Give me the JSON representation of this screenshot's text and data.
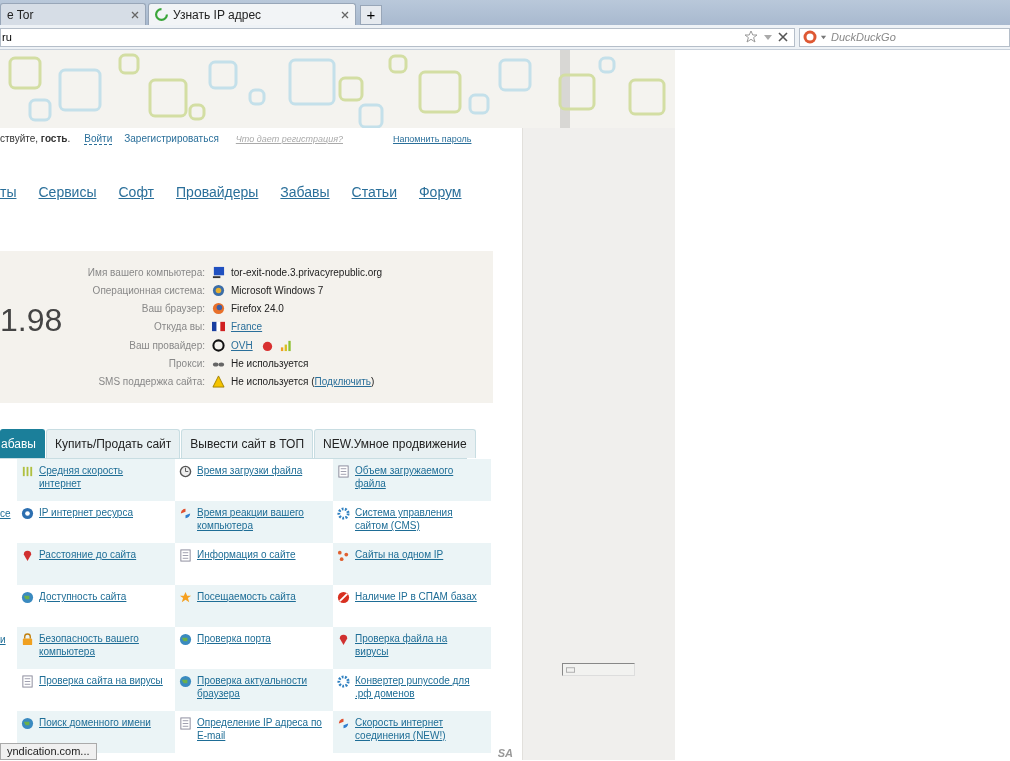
{
  "browser": {
    "tabs": [
      {
        "label": "e Tor",
        "selected": false
      },
      {
        "label": "Узнать IP адрес",
        "selected": true
      }
    ],
    "new_tab": "+",
    "address": "ru",
    "search_placeholder": "DuckDuckGo"
  },
  "login": {
    "greeting": "ствуйте, **гость**.",
    "login": "Войти",
    "register": "Зарегистрироваться",
    "why": "Что дает регистрация?",
    "remind": "Напомнить пароль"
  },
  "nav": [
    "ты",
    "Сервисы",
    "Софт",
    "Провайдеры",
    "Забавы",
    "Статьи",
    "Форум"
  ],
  "ip": "1.98",
  "info": [
    {
      "label": "Имя вашего компьютера:",
      "value": "tor-exit-node.3.privacyrepublic.org",
      "link": false
    },
    {
      "label": "Операционная система:",
      "value": "Microsoft Windows 7",
      "link": false
    },
    {
      "label": "Ваш браузер:",
      "value": "Firefox 24.0",
      "link": false
    },
    {
      "label": "Откуда вы:",
      "value": "France",
      "link": true
    },
    {
      "label": "Ваш провайдер:",
      "value": "OVH",
      "link": true
    },
    {
      "label": "Прокси:",
      "value": "Не используется",
      "link": false
    },
    {
      "label": "SMS поддержка сайта:",
      "value": "Не используется (",
      "link": false,
      "link_text": "Подключить",
      "tail": ")"
    }
  ],
  "site_tabs": [
    {
      "label": "абавы",
      "selected": true
    },
    {
      "label": "Купить/Продать сайт",
      "selected": false
    },
    {
      "label": "Вывести сайт в ТОП",
      "selected": false
    },
    {
      "label": "NEW.Умное продвижение",
      "selected": false
    }
  ],
  "services": [
    {
      "cells": [
        "Средняя скорость интернет",
        "Время загрузки файла",
        "Объем загружаемого файла"
      ]
    },
    {
      "edge": "се",
      "cells": [
        "IP интернет ресурса",
        "Время реакции вашего компьютера",
        "Система управления сайтом (CMS)"
      ]
    },
    {
      "cells": [
        "Расстояние до сайта",
        "Информация о сайте",
        "Сайты на одном IP"
      ]
    },
    {
      "cells": [
        "Доступность сайта",
        "Посещаемость сайта",
        "Наличие IP в СПАМ базах"
      ]
    },
    {
      "edge": "и",
      "cells": [
        "Безопасность вашего компьютера",
        "Проверка порта",
        "Проверка файла на вирусы"
      ]
    },
    {
      "cells": [
        "Проверка сайта на вирусы",
        "Проверка актуальности браузера",
        "Конвертер punycode для .рф доменов"
      ]
    },
    {
      "cells": [
        "Поиск доменного имени",
        "Определение IP адреса по E-mail",
        "Скорость интернет соединения (NEW!)"
      ]
    }
  ],
  "corner_logo": "SA",
  "status": "yndication.com..."
}
